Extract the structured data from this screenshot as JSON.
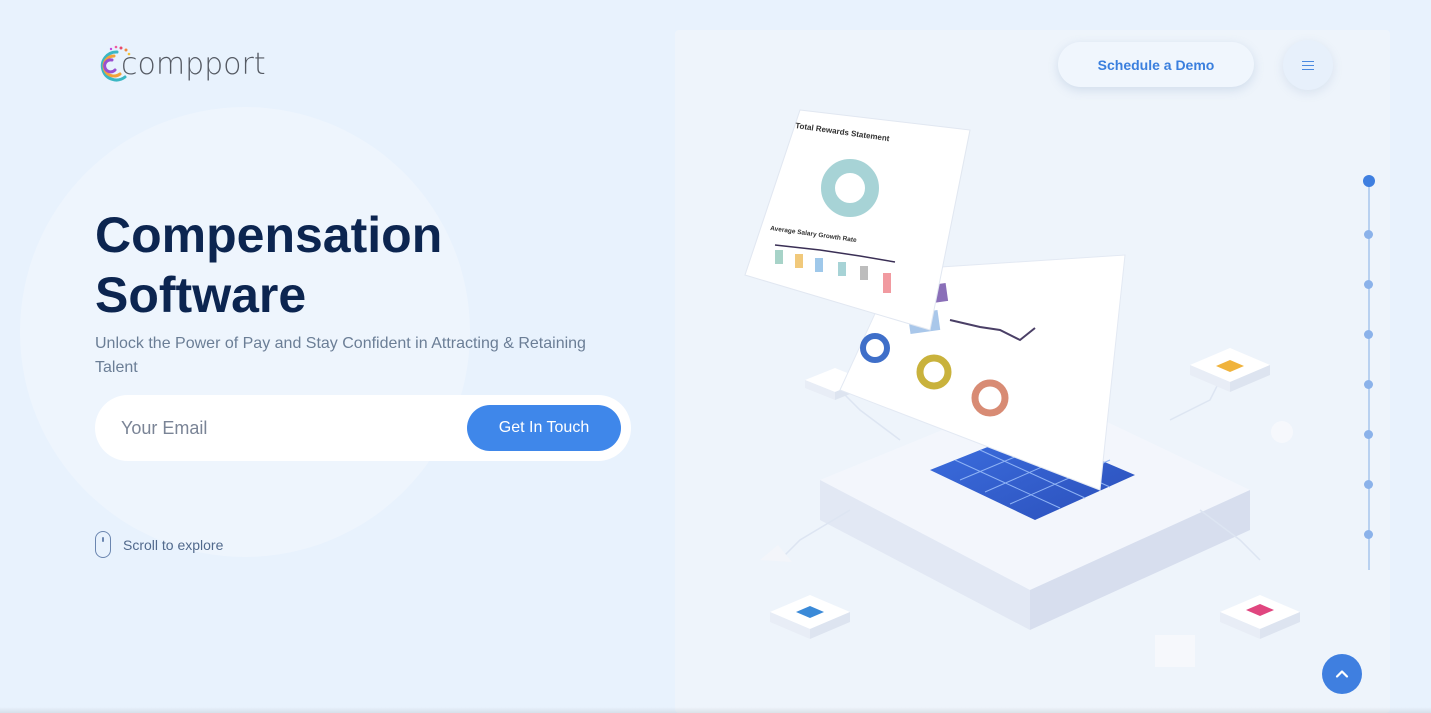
{
  "brand": {
    "name": "compport"
  },
  "header": {
    "demo_label": "Schedule a Demo"
  },
  "hero": {
    "title_line1": "Compensation",
    "title_line2": "Software",
    "subtitle": "Unlock the Power of Pay and Stay Confident in Attracting & Retaining Talent"
  },
  "form": {
    "email_placeholder": "Your Email",
    "email_value": "",
    "submit_label": "Get In Touch"
  },
  "scroll": {
    "label": "Scroll to explore"
  },
  "section_nav": {
    "count": 8,
    "active_index": 0
  },
  "illustration": {
    "panel_title": "Total Rewards Statement",
    "chart_title": "Average Salary Growth Rate"
  },
  "colors": {
    "background": "#e8f2fd",
    "accent": "#3f87ea",
    "title": "#0c2550",
    "text": "#6b7e96"
  },
  "icons": {
    "menu": "hamburger-icon",
    "scroll": "mouse-icon",
    "back_to_top": "chevron-up-icon"
  }
}
